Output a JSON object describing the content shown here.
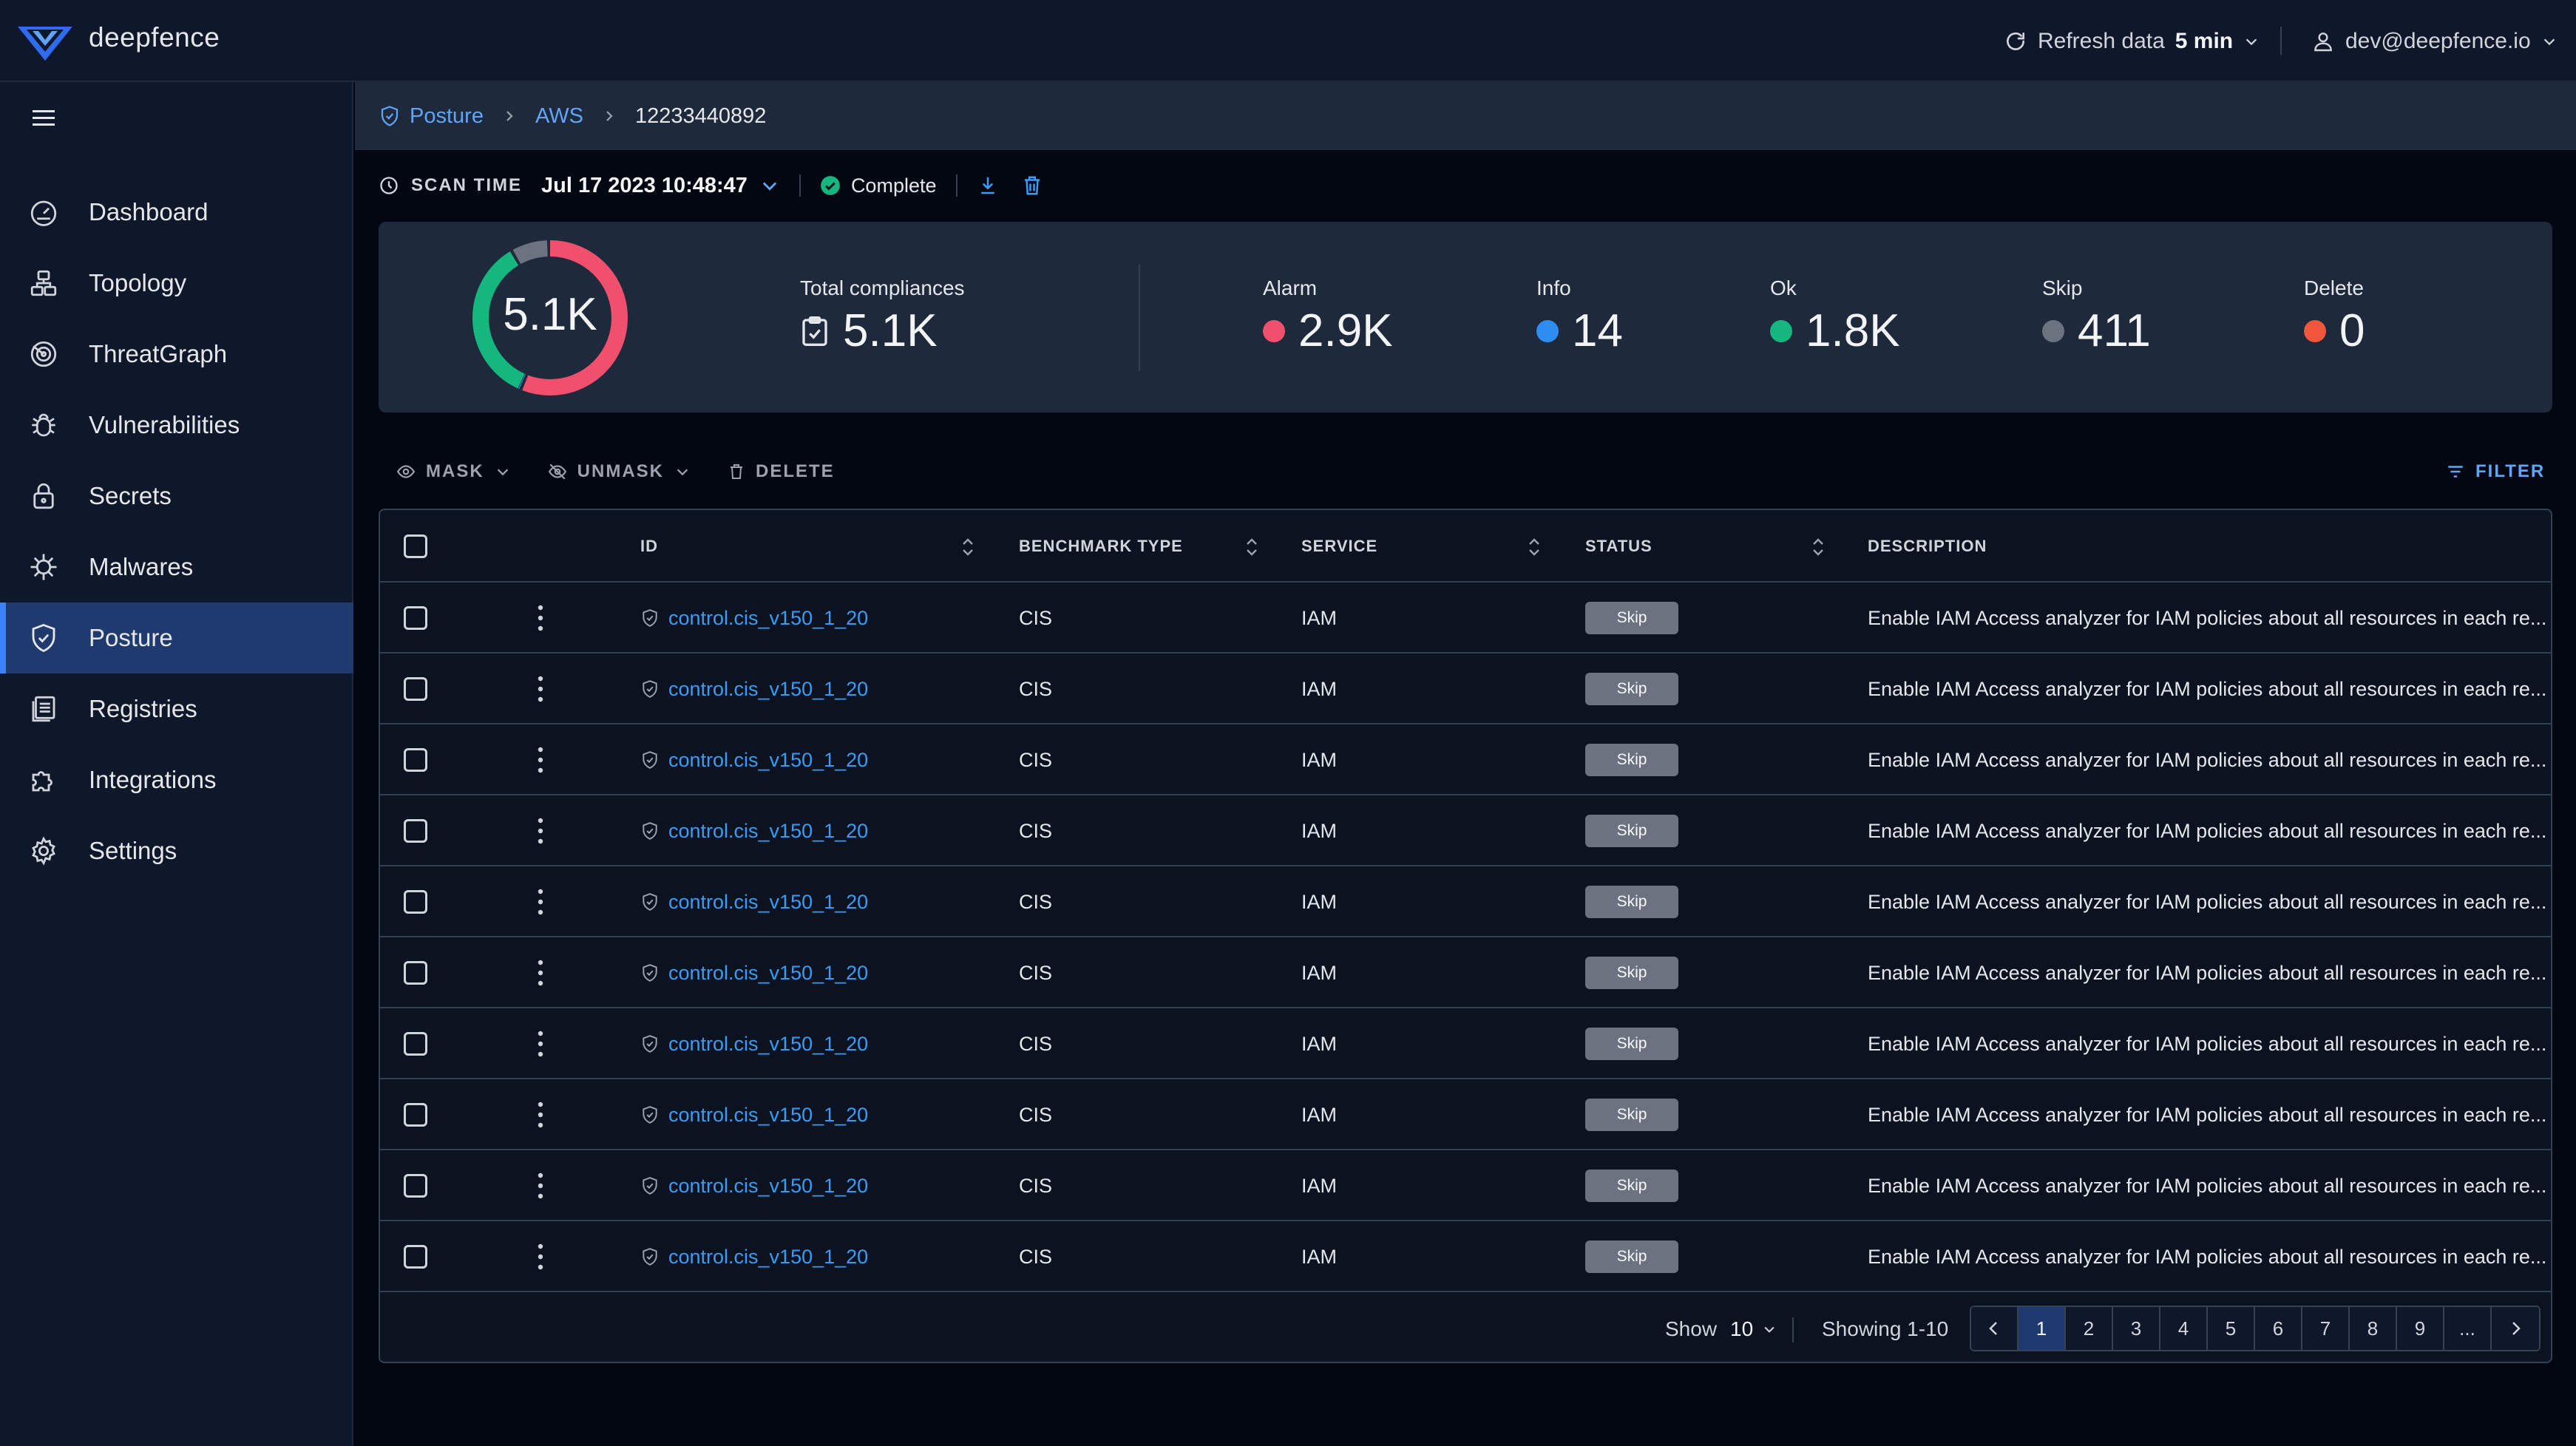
{
  "app": {
    "brand": "deepfence"
  },
  "topbar": {
    "refresh_label": "Refresh data",
    "refresh_interval": "5 min",
    "user_email": "dev@deepfence.io"
  },
  "sidebar": {
    "items": [
      {
        "label": "Dashboard",
        "icon": "dashboard-icon"
      },
      {
        "label": "Topology",
        "icon": "topology-icon"
      },
      {
        "label": "ThreatGraph",
        "icon": "threatgraph-icon"
      },
      {
        "label": "Vulnerabilities",
        "icon": "bug-icon"
      },
      {
        "label": "Secrets",
        "icon": "lock-icon"
      },
      {
        "label": "Malwares",
        "icon": "malware-icon"
      },
      {
        "label": "Posture",
        "icon": "shield-icon",
        "active": true
      },
      {
        "label": "Registries",
        "icon": "registry-icon"
      },
      {
        "label": "Integrations",
        "icon": "puzzle-icon"
      },
      {
        "label": "Settings",
        "icon": "gear-icon"
      }
    ]
  },
  "breadcrumb": {
    "items": [
      "Posture",
      "AWS",
      "12233440892"
    ]
  },
  "scan": {
    "label": "SCAN TIME",
    "time": "Jul 17 2023 10:48:47",
    "status": "Complete"
  },
  "summary": {
    "donut_label": "5.1K",
    "total_label": "Total compliances",
    "total_value": "5.1K",
    "stats": [
      {
        "label": "Alarm",
        "value": "2.9K",
        "color": "#f0506e"
      },
      {
        "label": "Info",
        "value": "14",
        "color": "#2f8cf0"
      },
      {
        "label": "Ok",
        "value": "1.8K",
        "color": "#15b77e"
      },
      {
        "label": "Skip",
        "value": "411",
        "color": "#6b7280"
      },
      {
        "label": "Delete",
        "value": "0",
        "color": "#f0563c"
      }
    ]
  },
  "actions": {
    "mask": "MASK",
    "unmask": "UNMASK",
    "delete": "DELETE",
    "filter": "FILTER"
  },
  "table": {
    "headers": {
      "id": "ID",
      "benchmark": "BENCHMARK TYPE",
      "service": "SERVICE",
      "status": "STATUS",
      "description": "DESCRIPTION"
    },
    "rows": [
      {
        "id": "control.cis_v150_1_20",
        "benchmark": "CIS",
        "service": "IAM",
        "status": "Skip",
        "description": "Enable IAM Access analyzer for IAM policies about all resources in each re..."
      },
      {
        "id": "control.cis_v150_1_20",
        "benchmark": "CIS",
        "service": "IAM",
        "status": "Skip",
        "description": "Enable IAM Access analyzer for IAM policies about all resources in each re..."
      },
      {
        "id": "control.cis_v150_1_20",
        "benchmark": "CIS",
        "service": "IAM",
        "status": "Skip",
        "description": "Enable IAM Access analyzer for IAM policies about all resources in each re..."
      },
      {
        "id": "control.cis_v150_1_20",
        "benchmark": "CIS",
        "service": "IAM",
        "status": "Skip",
        "description": "Enable IAM Access analyzer for IAM policies about all resources in each re..."
      },
      {
        "id": "control.cis_v150_1_20",
        "benchmark": "CIS",
        "service": "IAM",
        "status": "Skip",
        "description": "Enable IAM Access analyzer for IAM policies about all resources in each re..."
      },
      {
        "id": "control.cis_v150_1_20",
        "benchmark": "CIS",
        "service": "IAM",
        "status": "Skip",
        "description": "Enable IAM Access analyzer for IAM policies about all resources in each re..."
      },
      {
        "id": "control.cis_v150_1_20",
        "benchmark": "CIS",
        "service": "IAM",
        "status": "Skip",
        "description": "Enable IAM Access analyzer for IAM policies about all resources in each re..."
      },
      {
        "id": "control.cis_v150_1_20",
        "benchmark": "CIS",
        "service": "IAM",
        "status": "Skip",
        "description": "Enable IAM Access analyzer for IAM policies about all resources in each re..."
      },
      {
        "id": "control.cis_v150_1_20",
        "benchmark": "CIS",
        "service": "IAM",
        "status": "Skip",
        "description": "Enable IAM Access analyzer for IAM policies about all resources in each re..."
      },
      {
        "id": "control.cis_v150_1_20",
        "benchmark": "CIS",
        "service": "IAM",
        "status": "Skip",
        "description": "Enable IAM Access analyzer for IAM policies about all resources in each re..."
      }
    ]
  },
  "pagination": {
    "show_label": "Show",
    "page_size": "10",
    "showing": "Showing 1-10",
    "pages": [
      "1",
      "2",
      "3",
      "4",
      "5",
      "6",
      "7",
      "8",
      "9",
      "..."
    ],
    "current": "1"
  }
}
